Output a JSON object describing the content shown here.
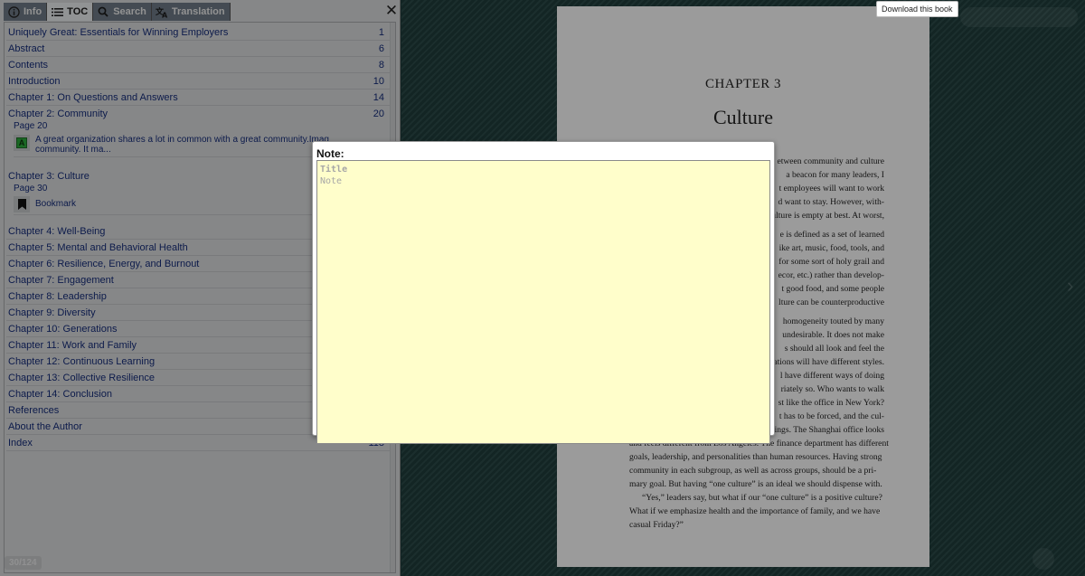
{
  "tabs": [
    {
      "label": "Info",
      "icon": "info-icon"
    },
    {
      "label": "TOC",
      "icon": "list-icon"
    },
    {
      "label": "Search",
      "icon": "search-icon"
    },
    {
      "label": "Translation",
      "icon": "translate-icon"
    }
  ],
  "toc": {
    "items": [
      {
        "title": "Uniquely Great: Essentials for Winning Employers",
        "page": "1"
      },
      {
        "title": "Abstract",
        "page": "6"
      },
      {
        "title": "Contents",
        "page": "8"
      },
      {
        "title": "Introduction",
        "page": "10"
      },
      {
        "title": "Chapter 1: On Questions and Answers",
        "page": "14"
      },
      {
        "title": "Chapter 2: Community",
        "page": "20"
      },
      {
        "title": "Chapter 3: Culture",
        "page": ""
      },
      {
        "title": "Chapter 4: Well-Being",
        "page": ""
      },
      {
        "title": "Chapter 5: Mental and Behavioral Health",
        "page": ""
      },
      {
        "title": "Chapter 6: Resilience, Energy, and Burnout",
        "page": ""
      },
      {
        "title": "Chapter 7: Engagement",
        "page": ""
      },
      {
        "title": "Chapter 8: Leadership",
        "page": ""
      },
      {
        "title": "Chapter 9: Diversity",
        "page": ""
      },
      {
        "title": "Chapter 10: Generations",
        "page": ""
      },
      {
        "title": "Chapter 11: Work and Family",
        "page": ""
      },
      {
        "title": "Chapter 12: Continuous Learning",
        "page": ""
      },
      {
        "title": "Chapter 13: Collective Resilience",
        "page": ""
      },
      {
        "title": "Chapter 14: Conclusion",
        "page": ""
      },
      {
        "title": "References",
        "page": ""
      },
      {
        "title": "About the Author",
        "page": ""
      },
      {
        "title": "Index",
        "page": "118"
      }
    ],
    "annotations": [
      {
        "page_label": "Page 20",
        "text_line1": "A great organization shares a lot in common with a great community.Imag",
        "text_line2": "community. It ma..."
      },
      {
        "page_label": "Page 30",
        "text_line1": "Bookmark",
        "text_line2": ""
      }
    ]
  },
  "page_counter": "30/124",
  "book": {
    "chapter_label": "CHAPTER 3",
    "chapter_title": "Culture",
    "lines": [
      "etween community and culture",
      "a beacon for many leaders, I",
      "t employees will want to work",
      "d want to stay. However, with-",
      "ulture is empty at best. At worst,",
      "e is defined as a set of learned",
      "ike art, music, food, tools, and",
      "for some sort of holy grail and",
      "ecor, etc.) rather than develop-",
      "t good food, and some people",
      "lture can be counterproductive",
      "homogeneity touted by many",
      "undesirable. It does not make",
      "s should all look and feel the",
      "ations will have different styles.",
      "l have different ways of doing",
      "riately so. Who wants to walk",
      "st like the office in New York?",
      "t has to be forced, and the cul-",
      "ings. The Shanghai office looks",
      "and feels different from Los Angeles. The finance department has different",
      "goals, leadership, and personalities than human resources. Having strong",
      "community in each subgroup, as well as across groups, should be a pri-",
      "mary goal. But having “one culture” is an ideal we should dispense with.",
      "“Yes,” leaders say, but what if our “one culture” is a positive culture?",
      "What if we emphasize health and the importance of family, and we have",
      "casual Friday?”"
    ]
  },
  "download_tooltip": "Download this book",
  "note_dialog": {
    "label": "Note:",
    "title_placeholder": "Title",
    "note_placeholder": "Note",
    "bg_color": "#fffecb"
  }
}
